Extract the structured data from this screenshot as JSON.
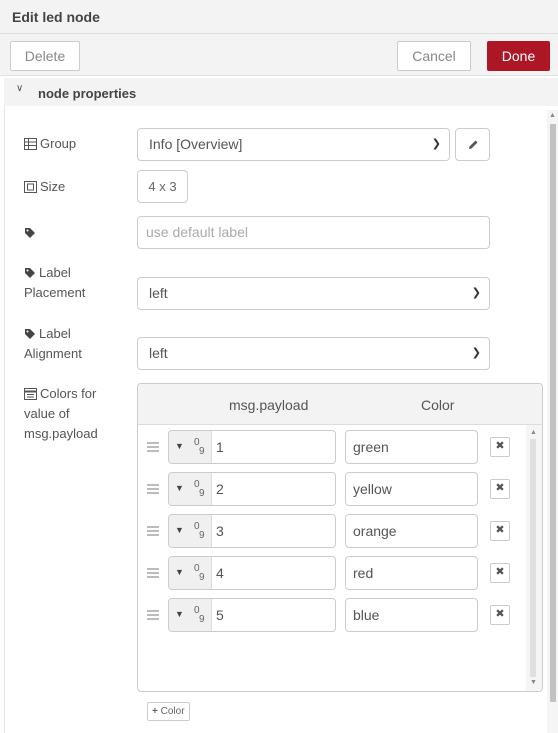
{
  "header": {
    "title": "Edit led node"
  },
  "toolbar": {
    "delete_label": "Delete",
    "cancel_label": "Cancel",
    "done_label": "Done",
    "done_color": "#ad1625"
  },
  "section": {
    "title": "node properties"
  },
  "fields": {
    "group": {
      "label": "Group",
      "value": "Info [Overview]"
    },
    "size": {
      "label": "Size",
      "value": "4 x 3"
    },
    "label": {
      "placeholder": "use default label"
    },
    "label_placement": {
      "label_line1": "Label",
      "label_line2": "Placement",
      "value": "left"
    },
    "label_alignment": {
      "label_line1": "Label",
      "label_line2": "Alignment",
      "value": "left"
    },
    "colors": {
      "label_line1": "Colors for",
      "label_line2": "value of",
      "label_line3": "msg.payload"
    }
  },
  "colors_table": {
    "col_payload": "msg.payload",
    "col_color": "Color",
    "rows": [
      {
        "payload": "1",
        "color": "green"
      },
      {
        "payload": "2",
        "color": "yellow"
      },
      {
        "payload": "3",
        "color": "orange"
      },
      {
        "payload": "4",
        "color": "red"
      },
      {
        "payload": "5",
        "color": "blue"
      }
    ],
    "add_label": "Color"
  }
}
